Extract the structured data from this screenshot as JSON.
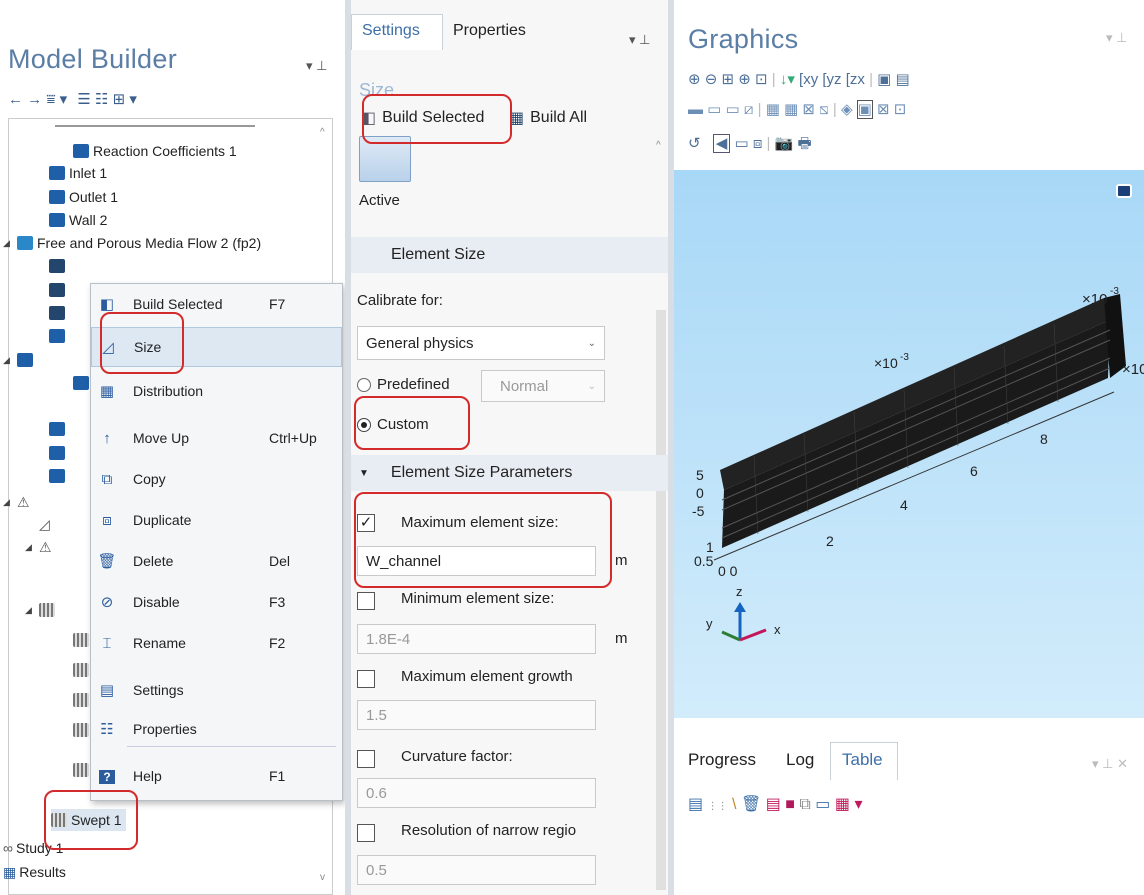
{
  "model_builder": {
    "title": "Model Builder",
    "tree": [
      {
        "label": "Reaction Coefficients 1"
      },
      {
        "label": "Inlet 1"
      },
      {
        "label": "Outlet 1"
      },
      {
        "label": "Wall 2"
      },
      {
        "label": "Free and Porous Media Flow 2 (fp2)"
      },
      {
        "label": "Swept 1"
      },
      {
        "label": "Study 1"
      },
      {
        "label": "Results"
      }
    ]
  },
  "context_menu": {
    "items": [
      {
        "label": "Build Selected",
        "key": "F7",
        "icon": "build-selected-icon"
      },
      {
        "label": "Size",
        "key": "",
        "icon": "size-icon"
      },
      {
        "label": "Distribution",
        "key": "",
        "icon": "distribution-icon"
      },
      {
        "label": "Move Up",
        "key": "Ctrl+Up",
        "icon": "arrow-up-icon"
      },
      {
        "label": "Copy",
        "key": "",
        "icon": "copy-icon"
      },
      {
        "label": "Duplicate",
        "key": "",
        "icon": "duplicate-icon"
      },
      {
        "label": "Delete",
        "key": "Del",
        "icon": "trash-icon"
      },
      {
        "label": "Disable",
        "key": "F3",
        "icon": "disable-icon"
      },
      {
        "label": "Rename",
        "key": "F2",
        "icon": "rename-icon"
      },
      {
        "label": "Settings",
        "key": "",
        "icon": "settings-icon"
      },
      {
        "label": "Properties",
        "key": "",
        "icon": "properties-icon"
      },
      {
        "label": "Help",
        "key": "F1",
        "icon": "help-icon"
      }
    ]
  },
  "settings": {
    "tabs": [
      "Settings",
      "Properties"
    ],
    "heading": "Size",
    "build_selected": "Build Selected",
    "build_all": "Build All",
    "active_label": "Active",
    "element_size_header": "Element Size",
    "calibrate_label": "Calibrate for:",
    "calibrate_value": "General physics",
    "predefined_label": "Predefined",
    "predefined_value": "Normal",
    "custom_label": "Custom",
    "params_header": "Element Size Parameters",
    "max_size_label": "Maximum element size:",
    "max_size_value": "W_channel",
    "min_size_label": "Minimum element size:",
    "min_size_value": "1.8E-4",
    "growth_label": "Maximum element growth",
    "growth_value": "1.5",
    "curvature_label": "Curvature factor:",
    "curvature_value": "0.6",
    "narrow_label": "Resolution of narrow regio",
    "narrow_value": "0.5",
    "unit": "m"
  },
  "graphics": {
    "title": "Graphics",
    "exp_label": "×10",
    "exp_sup": "-3",
    "exp_label2": "×10",
    "exp_sup2": "-3",
    "exp_label3": "×10",
    "ticks_x": [
      "2",
      "4",
      "6",
      "8"
    ],
    "ticks_left": [
      "5",
      "0",
      "-5"
    ],
    "tick_small": "0.5",
    "tick_zero": "0 0",
    "tick_one": "1",
    "axis_y": "y",
    "axis_z": "z",
    "axis_x": "x"
  },
  "bottom_tabs": [
    "Progress",
    "Log",
    "Table"
  ]
}
